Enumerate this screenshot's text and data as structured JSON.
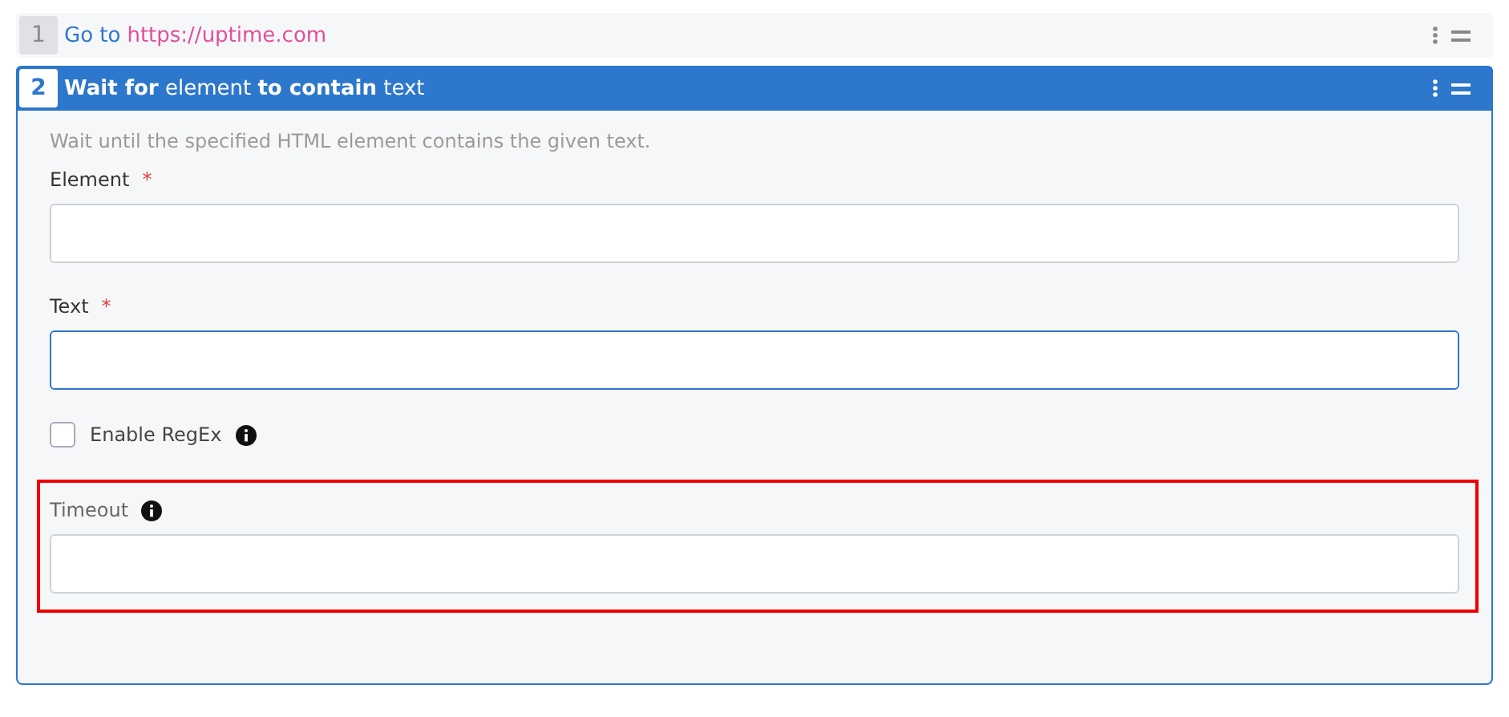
{
  "steps": [
    {
      "number": "1",
      "action": "Go to",
      "target": "https://uptime.com",
      "expanded": false
    },
    {
      "number": "2",
      "title": "**Wait for** element **to contain** text",
      "expanded": true,
      "description": "Wait until the specified HTML element contains the given text.",
      "fields": [
        {
          "kind": "input",
          "label": "Element",
          "required_mark": "*",
          "focused": false,
          "highlighted": false,
          "info": false
        },
        {
          "kind": "input",
          "label": "Text",
          "required_mark": "*",
          "focused": true,
          "highlighted": false,
          "info": false
        },
        {
          "kind": "checkbox",
          "label": "Enable RegEx",
          "checked": false,
          "info": true
        },
        {
          "kind": "input",
          "label": "Timeout",
          "focused": false,
          "highlighted": true,
          "info": true
        }
      ]
    }
  ]
}
